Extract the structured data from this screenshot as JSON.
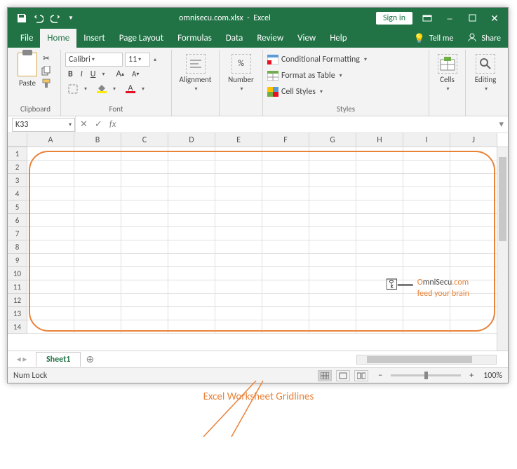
{
  "title": {
    "filename": "omnisecu.com.xlsx",
    "app": "Excel"
  },
  "signin": "Sign in",
  "tabs": {
    "file": "File",
    "home": "Home",
    "insert": "Insert",
    "pagelayout": "Page Layout",
    "formulas": "Formulas",
    "data": "Data",
    "review": "Review",
    "view": "View",
    "help": "Help",
    "tellme": "Tell me",
    "share": "Share"
  },
  "ribbon": {
    "clipboard": {
      "label": "Clipboard",
      "paste": "Paste"
    },
    "font": {
      "label": "Font",
      "name": "Calibri",
      "size": "11",
      "bold": "B",
      "italic": "I",
      "underline": "U"
    },
    "alignment": {
      "label": "Alignment"
    },
    "number": {
      "label": "Number",
      "percent": "%"
    },
    "styles": {
      "label": "Styles",
      "cond": "Conditional Formatting",
      "table": "Format as Table",
      "cell": "Cell Styles"
    },
    "cells": {
      "label": "Cells"
    },
    "editing": {
      "label": "Editing"
    }
  },
  "namebox": "K33",
  "columns": [
    "A",
    "B",
    "C",
    "D",
    "E",
    "F",
    "G",
    "H",
    "I",
    "J"
  ],
  "rows": [
    "1",
    "2",
    "3",
    "4",
    "5",
    "6",
    "7",
    "8",
    "9",
    "10",
    "11",
    "12",
    "13",
    "14"
  ],
  "sheet": {
    "name": "Sheet1"
  },
  "status": {
    "numlock": "Num Lock",
    "zoom": "100%"
  },
  "watermark": {
    "brand_prefix": "O",
    "brand_mid": "mniSecu",
    "brand_suffix": ".com",
    "tagline": "feed your brain"
  },
  "annotation": "Excel Worksheet Gridlines"
}
